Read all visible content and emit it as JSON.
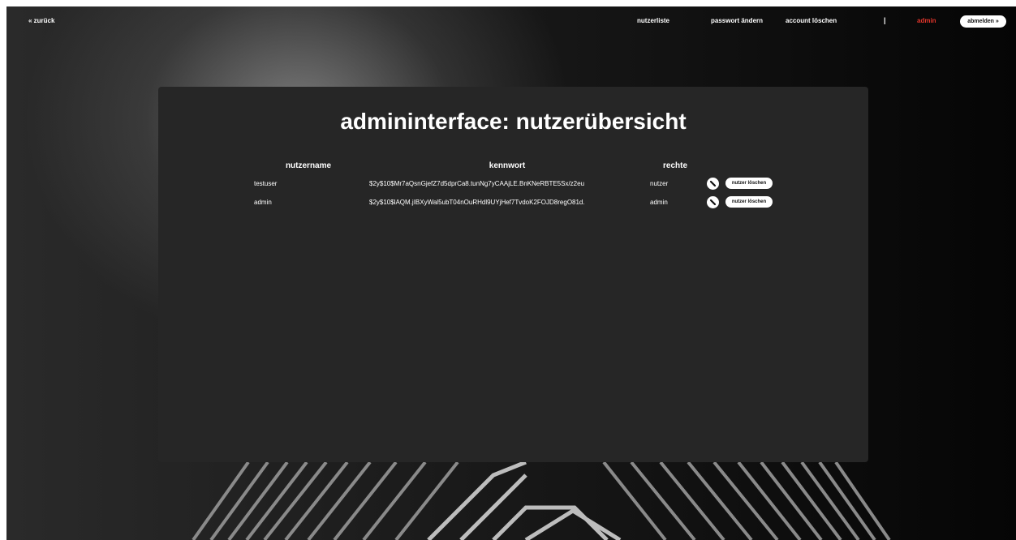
{
  "nav": {
    "back_label": "« zurück",
    "userlist_label": "nutzerliste",
    "change_password_label": "passwort ändern",
    "delete_account_label": "account löschen",
    "separator": "|",
    "current_user": "admin",
    "logout_label": "abmelden »"
  },
  "panel": {
    "title": "admininterface: nutzerübersicht",
    "columns": {
      "username": "nutzername",
      "password": "kennwort",
      "rights": "rechte"
    },
    "users": [
      {
        "username": "testuser",
        "password_hash": "$2y$10$Mr7aQsnGjefZ7d5dprCa8.tunNg7yCAAjLE.BnKNeRBTE5Sx/z2eu",
        "rights": "nutzer",
        "edit_icon": "pencil-icon",
        "delete_label": "nutzer löschen"
      },
      {
        "username": "admin",
        "password_hash": "$2y$10$lAQM.jIBXyWal5ubT04nOuRHdl9UYjHef7TvdoK2FOJD8regO81d.",
        "rights": "admin",
        "edit_icon": "pencil-icon",
        "delete_label": "nutzer löschen"
      }
    ]
  },
  "colors": {
    "panel_background": "#262626",
    "admin_accent": "#e0352b",
    "text": "#ffffff"
  }
}
